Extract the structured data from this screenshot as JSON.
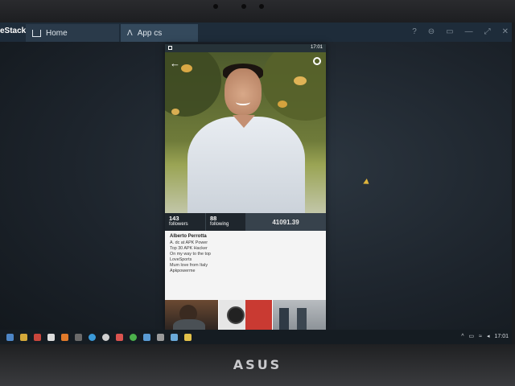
{
  "window": {
    "app_name": "eStacks",
    "tabs": [
      {
        "label": "Home",
        "icon": "home-icon"
      },
      {
        "label": "App cs",
        "icon": "app-icon"
      }
    ],
    "controls": [
      "?",
      "⊖",
      "▭",
      "—",
      "⤢",
      "✕"
    ]
  },
  "phone": {
    "status_time": "17:01",
    "profile": {
      "followers_count": "143",
      "followers_label": "followers",
      "following_count": "88",
      "following_label": "following",
      "value": "41091.39"
    },
    "bio": {
      "name": "Alberto Perrotta",
      "lines": [
        "A. dc at APK Power",
        "Top 30 APK Hacker",
        "On my way to the top",
        "LoveSports",
        "Mum love from Italy",
        "Apkpowerme"
      ]
    }
  },
  "taskbar": {
    "clock": "17:01"
  },
  "bezel": {
    "brand": "ASUS"
  },
  "colors": {
    "titlebar": "#1e2c3a",
    "accent_cursor": "#e0b53c"
  }
}
